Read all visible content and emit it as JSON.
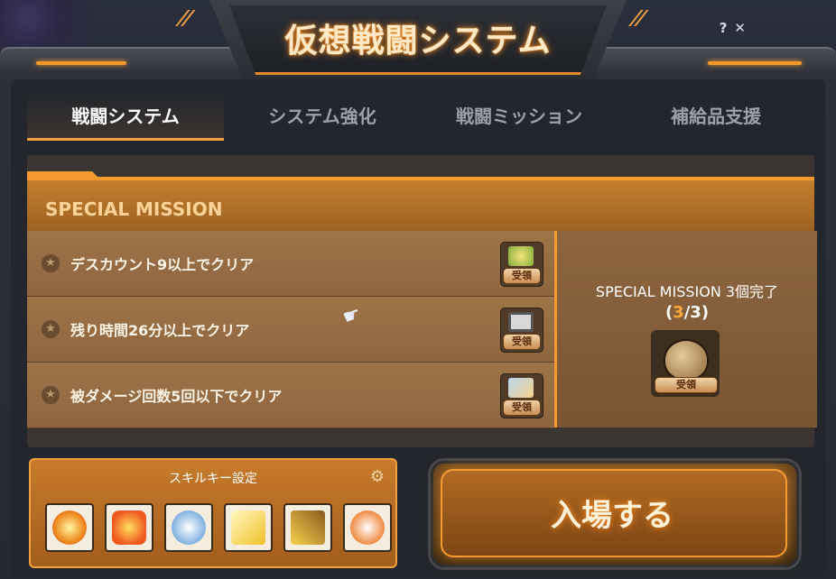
{
  "window": {
    "title": "仮想戦闘システム",
    "help_icon": "question-icon",
    "close_icon": "close-icon"
  },
  "tabs": [
    {
      "label": "戦闘システム",
      "active": true
    },
    {
      "label": "システム強化",
      "active": false
    },
    {
      "label": "戦闘ミッション",
      "active": false
    },
    {
      "label": "補給品支援",
      "active": false
    }
  ],
  "special_mission": {
    "title": "SPECIAL MISSION",
    "missions": [
      {
        "text": "デスカウント9以上でクリア",
        "reward_button": "受領",
        "reward_icon": "gift-box-icon"
      },
      {
        "text": "残り時間26分以上でクリア",
        "reward_button": "受領",
        "reward_icon": "monitor-icon"
      },
      {
        "text": "被ダメージ回数5回以下でクリア",
        "reward_button": "受領",
        "reward_icon": "portrait-icon"
      }
    ],
    "summary": {
      "text": "SPECIAL MISSION 3個完了",
      "count_current": "3",
      "count_total": "3",
      "reward_button": "受領",
      "reward_icon": "sack-icon"
    }
  },
  "skill_settings": {
    "title": "スキルキー設定",
    "gear_icon": "gear-icon",
    "skills": [
      "fireball-skill-icon",
      "burst-skill-icon",
      "spin-skill-icon",
      "beam-skill-icon",
      "lightning-skill-icon",
      "dash-skill-icon"
    ]
  },
  "enter_button": {
    "label": "入場する"
  },
  "colors": {
    "accent": "#f59a2e",
    "panel": "#9e7448",
    "frame": "#2d3038"
  }
}
